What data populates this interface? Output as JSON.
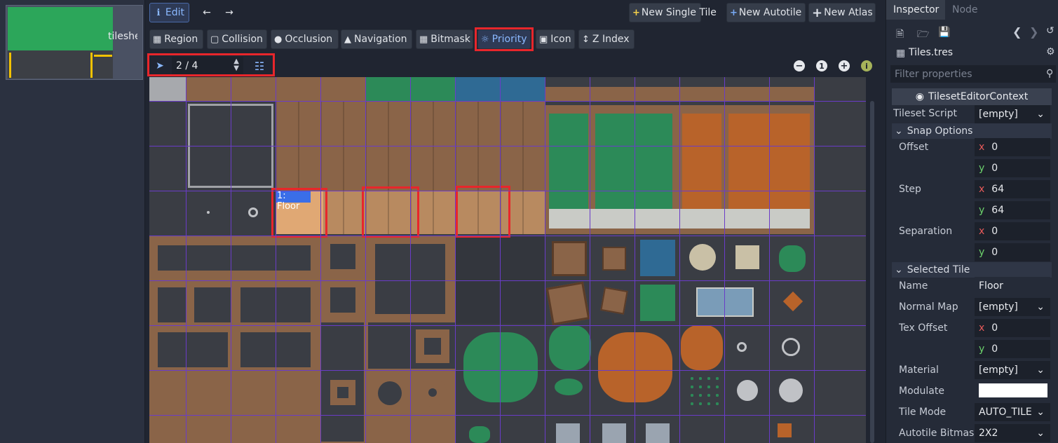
{
  "left_panel": {
    "thumbnail_label": "tileshe"
  },
  "toolbar": {
    "edit_label": "Edit",
    "new_single_tile": "New Single Tile",
    "new_autotile": "New Autotile",
    "new_atlas": "New Atlas"
  },
  "tabs": [
    "Region",
    "Collision",
    "Occlusion",
    "Navigation",
    "Bitmask",
    "Priority",
    "Icon",
    "Z Index"
  ],
  "active_tab": "Priority",
  "subtoolbar": {
    "spin_value": "2 / 4"
  },
  "tile_label": "1: Floor",
  "inspector": {
    "tabs": [
      "Inspector",
      "Node"
    ],
    "resource": "Tiles.tres",
    "filter_placeholder": "Filter properties",
    "context": "TilesetEditorContext",
    "tileset_script_label": "Tileset Script",
    "tileset_script_value": "[empty]",
    "snap_options": "Snap Options",
    "offset_label": "Offset",
    "offset_x": "0",
    "offset_y": "0",
    "step_label": "Step",
    "step_x": "64",
    "step_y": "64",
    "separation_label": "Separation",
    "separation_x": "0",
    "separation_y": "0",
    "selected_tile": "Selected Tile",
    "name_label": "Name",
    "name_value": "Floor",
    "normal_map_label": "Normal Map",
    "normal_map_value": "[empty]",
    "tex_offset_label": "Tex Offset",
    "tex_offset_x": "0",
    "tex_offset_y": "0",
    "material_label": "Material",
    "material_value": "[empty]",
    "modulate_label": "Modulate",
    "tile_mode_label": "Tile Mode",
    "tile_mode_value": "AUTO_TILE",
    "autotile_bitmask_label": "Autotile Bitmas",
    "autotile_bitmask_value": "2X2"
  },
  "colors": {
    "highlight": "#e8262b",
    "accent": "#8ab8ff",
    "grid": "#6a3cc8"
  }
}
